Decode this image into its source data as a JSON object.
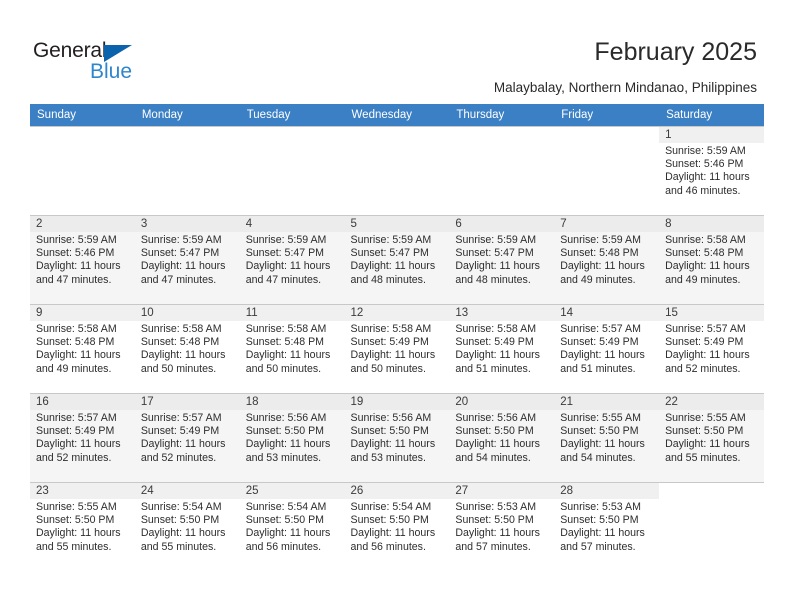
{
  "branding": {
    "name_top": "General",
    "name_bottom": "Blue",
    "triangle_color": "#0b63ad",
    "blue_color": "#2f86cd"
  },
  "header": {
    "title": "February 2025",
    "subtitle": "Malaybalay, Northern Mindanao, Philippines"
  },
  "theme": {
    "header_row_bg": "#3b7fc4",
    "header_row_text": "#ffffff",
    "row_shade_bg": "#f5f5f5",
    "day_number_bg": "#f0f0f0",
    "grid_line": "#c8c8c8"
  },
  "calendar": {
    "weekday_headers": [
      "Sunday",
      "Monday",
      "Tuesday",
      "Wednesday",
      "Thursday",
      "Friday",
      "Saturday"
    ],
    "labels": {
      "sunrise": "Sunrise:",
      "sunset": "Sunset:",
      "daylight": "Daylight:"
    },
    "weeks": [
      {
        "shaded": false,
        "days": [
          {
            "empty": true
          },
          {
            "empty": true
          },
          {
            "empty": true
          },
          {
            "empty": true
          },
          {
            "empty": true
          },
          {
            "empty": true
          },
          {
            "day": "1",
            "sunrise": "Sunrise: 5:59 AM",
            "sunset": "Sunset: 5:46 PM",
            "daylight": "Daylight: 11 hours and 46 minutes."
          }
        ]
      },
      {
        "shaded": true,
        "days": [
          {
            "day": "2",
            "sunrise": "Sunrise: 5:59 AM",
            "sunset": "Sunset: 5:46 PM",
            "daylight": "Daylight: 11 hours and 47 minutes."
          },
          {
            "day": "3",
            "sunrise": "Sunrise: 5:59 AM",
            "sunset": "Sunset: 5:47 PM",
            "daylight": "Daylight: 11 hours and 47 minutes."
          },
          {
            "day": "4",
            "sunrise": "Sunrise: 5:59 AM",
            "sunset": "Sunset: 5:47 PM",
            "daylight": "Daylight: 11 hours and 47 minutes."
          },
          {
            "day": "5",
            "sunrise": "Sunrise: 5:59 AM",
            "sunset": "Sunset: 5:47 PM",
            "daylight": "Daylight: 11 hours and 48 minutes."
          },
          {
            "day": "6",
            "sunrise": "Sunrise: 5:59 AM",
            "sunset": "Sunset: 5:47 PM",
            "daylight": "Daylight: 11 hours and 48 minutes."
          },
          {
            "day": "7",
            "sunrise": "Sunrise: 5:59 AM",
            "sunset": "Sunset: 5:48 PM",
            "daylight": "Daylight: 11 hours and 49 minutes."
          },
          {
            "day": "8",
            "sunrise": "Sunrise: 5:58 AM",
            "sunset": "Sunset: 5:48 PM",
            "daylight": "Daylight: 11 hours and 49 minutes."
          }
        ]
      },
      {
        "shaded": false,
        "days": [
          {
            "day": "9",
            "sunrise": "Sunrise: 5:58 AM",
            "sunset": "Sunset: 5:48 PM",
            "daylight": "Daylight: 11 hours and 49 minutes."
          },
          {
            "day": "10",
            "sunrise": "Sunrise: 5:58 AM",
            "sunset": "Sunset: 5:48 PM",
            "daylight": "Daylight: 11 hours and 50 minutes."
          },
          {
            "day": "11",
            "sunrise": "Sunrise: 5:58 AM",
            "sunset": "Sunset: 5:48 PM",
            "daylight": "Daylight: 11 hours and 50 minutes."
          },
          {
            "day": "12",
            "sunrise": "Sunrise: 5:58 AM",
            "sunset": "Sunset: 5:49 PM",
            "daylight": "Daylight: 11 hours and 50 minutes."
          },
          {
            "day": "13",
            "sunrise": "Sunrise: 5:58 AM",
            "sunset": "Sunset: 5:49 PM",
            "daylight": "Daylight: 11 hours and 51 minutes."
          },
          {
            "day": "14",
            "sunrise": "Sunrise: 5:57 AM",
            "sunset": "Sunset: 5:49 PM",
            "daylight": "Daylight: 11 hours and 51 minutes."
          },
          {
            "day": "15",
            "sunrise": "Sunrise: 5:57 AM",
            "sunset": "Sunset: 5:49 PM",
            "daylight": "Daylight: 11 hours and 52 minutes."
          }
        ]
      },
      {
        "shaded": true,
        "days": [
          {
            "day": "16",
            "sunrise": "Sunrise: 5:57 AM",
            "sunset": "Sunset: 5:49 PM",
            "daylight": "Daylight: 11 hours and 52 minutes."
          },
          {
            "day": "17",
            "sunrise": "Sunrise: 5:57 AM",
            "sunset": "Sunset: 5:49 PM",
            "daylight": "Daylight: 11 hours and 52 minutes."
          },
          {
            "day": "18",
            "sunrise": "Sunrise: 5:56 AM",
            "sunset": "Sunset: 5:50 PM",
            "daylight": "Daylight: 11 hours and 53 minutes."
          },
          {
            "day": "19",
            "sunrise": "Sunrise: 5:56 AM",
            "sunset": "Sunset: 5:50 PM",
            "daylight": "Daylight: 11 hours and 53 minutes."
          },
          {
            "day": "20",
            "sunrise": "Sunrise: 5:56 AM",
            "sunset": "Sunset: 5:50 PM",
            "daylight": "Daylight: 11 hours and 54 minutes."
          },
          {
            "day": "21",
            "sunrise": "Sunrise: 5:55 AM",
            "sunset": "Sunset: 5:50 PM",
            "daylight": "Daylight: 11 hours and 54 minutes."
          },
          {
            "day": "22",
            "sunrise": "Sunrise: 5:55 AM",
            "sunset": "Sunset: 5:50 PM",
            "daylight": "Daylight: 11 hours and 55 minutes."
          }
        ]
      },
      {
        "shaded": false,
        "days": [
          {
            "day": "23",
            "sunrise": "Sunrise: 5:55 AM",
            "sunset": "Sunset: 5:50 PM",
            "daylight": "Daylight: 11 hours and 55 minutes."
          },
          {
            "day": "24",
            "sunrise": "Sunrise: 5:54 AM",
            "sunset": "Sunset: 5:50 PM",
            "daylight": "Daylight: 11 hours and 55 minutes."
          },
          {
            "day": "25",
            "sunrise": "Sunrise: 5:54 AM",
            "sunset": "Sunset: 5:50 PM",
            "daylight": "Daylight: 11 hours and 56 minutes."
          },
          {
            "day": "26",
            "sunrise": "Sunrise: 5:54 AM",
            "sunset": "Sunset: 5:50 PM",
            "daylight": "Daylight: 11 hours and 56 minutes."
          },
          {
            "day": "27",
            "sunrise": "Sunrise: 5:53 AM",
            "sunset": "Sunset: 5:50 PM",
            "daylight": "Daylight: 11 hours and 57 minutes."
          },
          {
            "day": "28",
            "sunrise": "Sunrise: 5:53 AM",
            "sunset": "Sunset: 5:50 PM",
            "daylight": "Daylight: 11 hours and 57 minutes."
          },
          {
            "empty": true
          }
        ]
      }
    ]
  }
}
